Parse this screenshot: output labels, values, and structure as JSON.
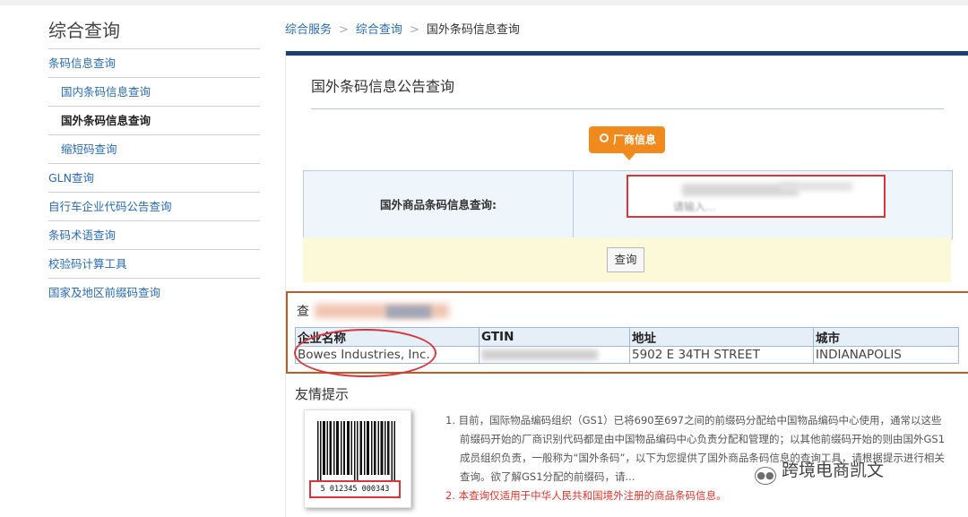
{
  "sidebar": {
    "title": "综合查询",
    "items": [
      {
        "label": "条码信息查询"
      },
      {
        "label": "国内条码信息查询"
      },
      {
        "label": "国外条码信息查询"
      },
      {
        "label": "缩短码查询"
      },
      {
        "label": "GLN查询"
      },
      {
        "label": "自行车企业代码公告查询"
      },
      {
        "label": "条码术语查询"
      },
      {
        "label": "校验码计算工具"
      },
      {
        "label": "国家及地区前缀码查询"
      }
    ]
  },
  "breadcrumb": {
    "items": [
      "综合服务",
      "综合查询",
      "国外条码信息查询"
    ],
    "separator": ">"
  },
  "main": {
    "title": "国外条码信息公告查询",
    "tab_label": "厂商信息",
    "query_label": "国外商品条码信息查询:",
    "query_placeholder": "请输入...",
    "query_button": "查询",
    "result_title_prefix": "查",
    "result_columns": [
      "企业名称",
      "GTIN",
      "地址",
      "城市"
    ],
    "result_row": {
      "company": "Bowes Industries, Inc.",
      "gtin": "",
      "address": "5902 E 34TH STREET",
      "city": "INDIANAPOLIS"
    }
  },
  "tips": {
    "title": "友情提示",
    "barcode_digits": "5 012345 000343",
    "line1": "1. 目前，国际物品编码组织（GS1）已将690至697之间的前缀码分配给中国物品编码中心使用，通常以这些前缀码开始的厂商识别代码都是由中国物品编码中心负责分配和管理的；以其他前缀码开始的则由国外GS1成员组织负责，一般称为“国外条码”，以下为您提供了国外商品条码信息的查询工具，请根据提示进行相关查询。欲了解GS1分配的前缀码，请...",
    "line2": "2. 本查询仅适用于中华人民共和国境外注册的商品条码信息。"
  },
  "watermark": {
    "text": "跨境电商凯文",
    "icon": "wechat-icon"
  },
  "colors": {
    "link": "#2a6bb0",
    "header_bar": "#1c3e72",
    "badge": "#f08a1c",
    "highlight_red": "#d9353b",
    "result_border": "#b8602a",
    "notice_red": "#e0362c"
  }
}
